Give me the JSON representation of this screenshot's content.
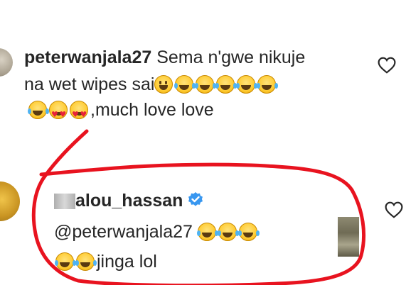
{
  "comments": [
    {
      "username": "peterwanjala27",
      "text_line1": " Sema n'gwe nikuje",
      "text_line2": "na wet wipes sai",
      "text_line3_suffix": ",much love love",
      "line2_emojis": [
        "grinning-face",
        "face-with-tears-of-joy",
        "face-with-tears-of-joy",
        "face-with-tears-of-joy",
        "face-with-tears-of-joy",
        "face-with-tears-of-joy"
      ],
      "line3_emojis": [
        "face-with-tears-of-joy",
        "smiling-face-with-heart-eyes",
        "smiling-face-with-heart-eyes"
      ]
    },
    {
      "username": "alou_hassan",
      "verified": true,
      "mention": "@peterwanjala27 ",
      "text_suffix": "jinga lol",
      "line1_emojis": [
        "face-with-tears-of-joy",
        "face-with-tears-of-joy",
        "face-with-tears-of-joy"
      ],
      "line2_emojis": [
        "face-with-tears-of-joy",
        "face-with-tears-of-joy"
      ]
    }
  ],
  "icons": {
    "like": "heart-outline-icon",
    "verified": "verified-badge-icon"
  },
  "colors": {
    "text": "#262626",
    "verified_blue": "#3897f0",
    "annotation_red": "#e8131f"
  }
}
